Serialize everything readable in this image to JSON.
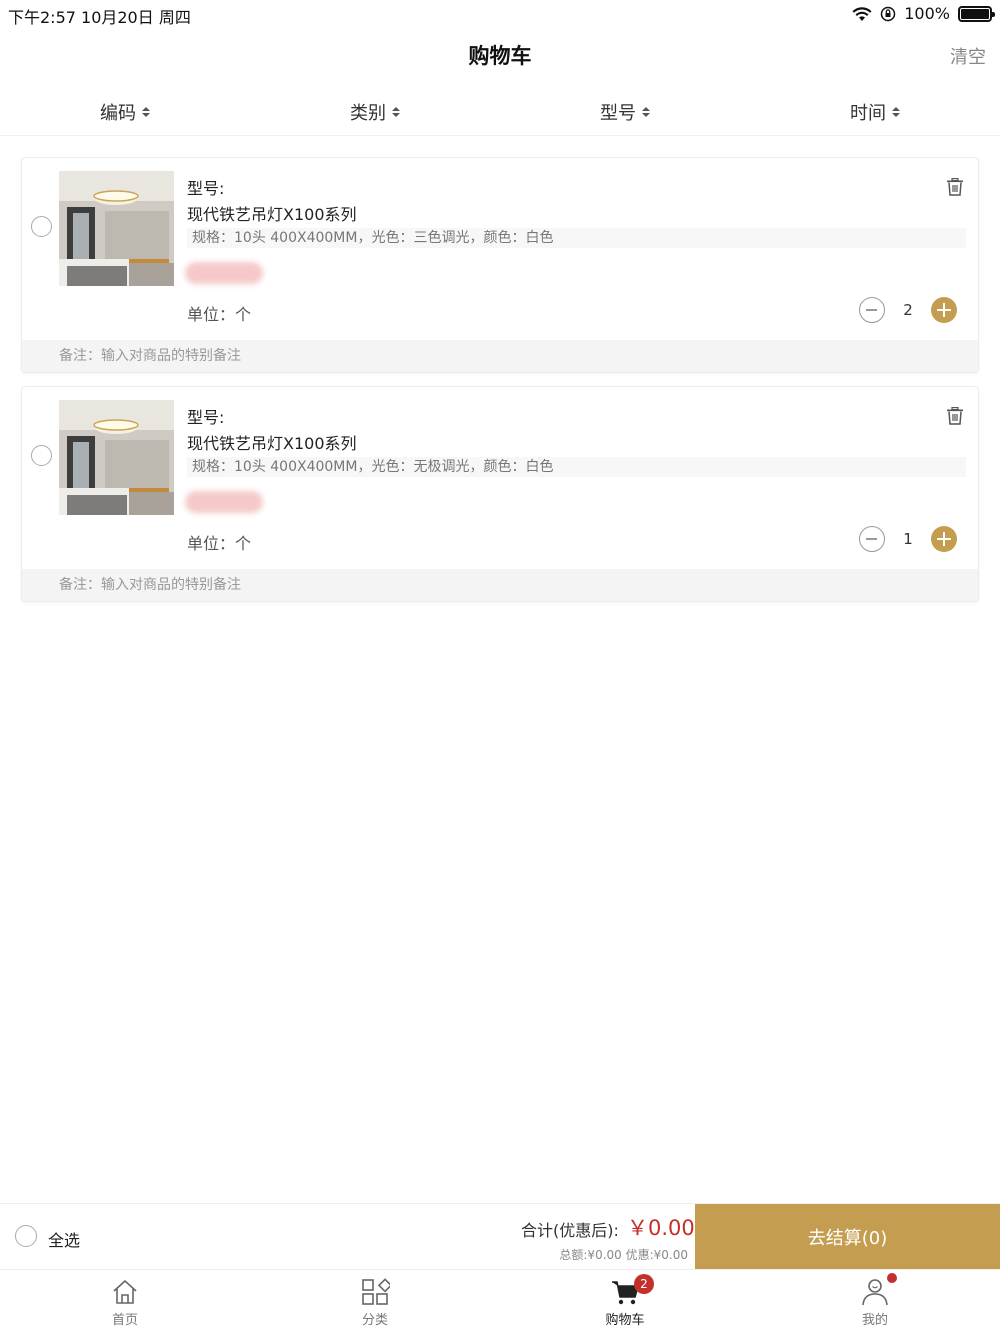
{
  "status_bar": {
    "time": "下午2:57   10月20日 周四",
    "battery_percent": "100%"
  },
  "nav": {
    "title": "购物车",
    "clear_label": "清空"
  },
  "sort_bar": {
    "items": [
      {
        "label": "编码"
      },
      {
        "label": "类别"
      },
      {
        "label": "型号"
      },
      {
        "label": "时间"
      }
    ]
  },
  "cart": {
    "items": [
      {
        "model_label": "型号:",
        "name": "现代铁艺吊灯X100系列",
        "spec": "规格：10头 400X400MM，光色：三色调光，颜色：白色",
        "unit": "单位：个",
        "quantity": "2",
        "note_placeholder": "备注：输入对商品的特别备注"
      },
      {
        "model_label": "型号:",
        "name": "现代铁艺吊灯X100系列",
        "spec": "规格：10头 400X400MM，光色：无极调光，颜色：白色",
        "unit": "单位：个",
        "quantity": "1",
        "note_placeholder": "备注：输入对商品的特别备注"
      }
    ]
  },
  "checkout": {
    "select_all_label": "全选",
    "total_label": "合计(优惠后):",
    "total_amount": "￥0.00",
    "sub_total": "总额:¥0.00 优惠:¥0.00",
    "button_label": "去结算(0)"
  },
  "tab_bar": {
    "tabs": [
      {
        "label": "首页",
        "icon": "home-icon"
      },
      {
        "label": "分类",
        "icon": "category-icon"
      },
      {
        "label": "购物车",
        "icon": "cart-icon",
        "badge": "2"
      },
      {
        "label": "我的",
        "icon": "user-icon"
      }
    ]
  },
  "colors": {
    "accent": "#c59d50",
    "price_red": "#c4302b"
  }
}
